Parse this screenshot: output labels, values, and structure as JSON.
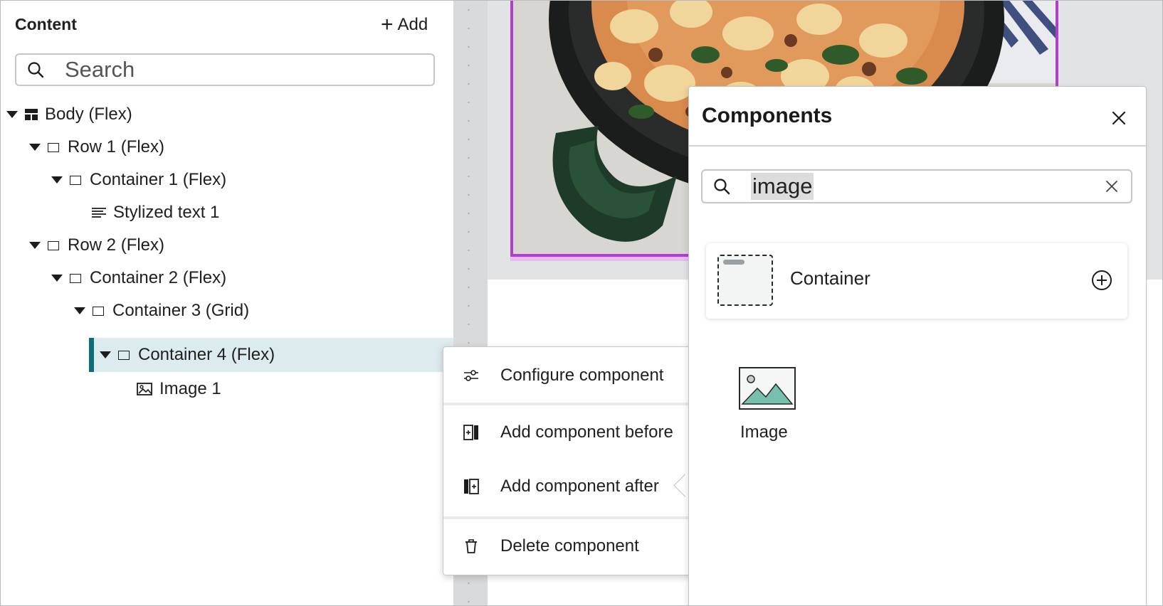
{
  "content_panel": {
    "title": "Content",
    "add_label": "Add",
    "search_placeholder": "Search"
  },
  "tree": [
    {
      "label": "Body (Flex)",
      "icon": "layout-icon"
    },
    {
      "label": "Row 1 (Flex)",
      "icon": "box-icon"
    },
    {
      "label": "Container 1 (Flex)",
      "icon": "box-icon"
    },
    {
      "label": "Stylized text 1",
      "icon": "text-lines-icon"
    },
    {
      "label": "Row 2 (Flex)",
      "icon": "box-icon"
    },
    {
      "label": "Container 2 (Flex)",
      "icon": "box-icon"
    },
    {
      "label": "Container 3 (Grid)",
      "icon": "box-icon"
    },
    {
      "label": "Container 4 (Flex)",
      "icon": "box-icon",
      "selected": true
    },
    {
      "label": "Image 1",
      "icon": "image-icon"
    }
  ],
  "context_menu": {
    "configure": "Configure component",
    "add_before": "Add component before",
    "add_after": "Add component after",
    "delete": "Delete component"
  },
  "components_panel": {
    "title": "Components",
    "search_value": "image",
    "results": {
      "container": "Container",
      "image": "Image"
    }
  },
  "colors": {
    "selected_bg": "#dcebed",
    "selected_accent": "#0e6e78",
    "image_selection_border": "#b23ed1"
  }
}
